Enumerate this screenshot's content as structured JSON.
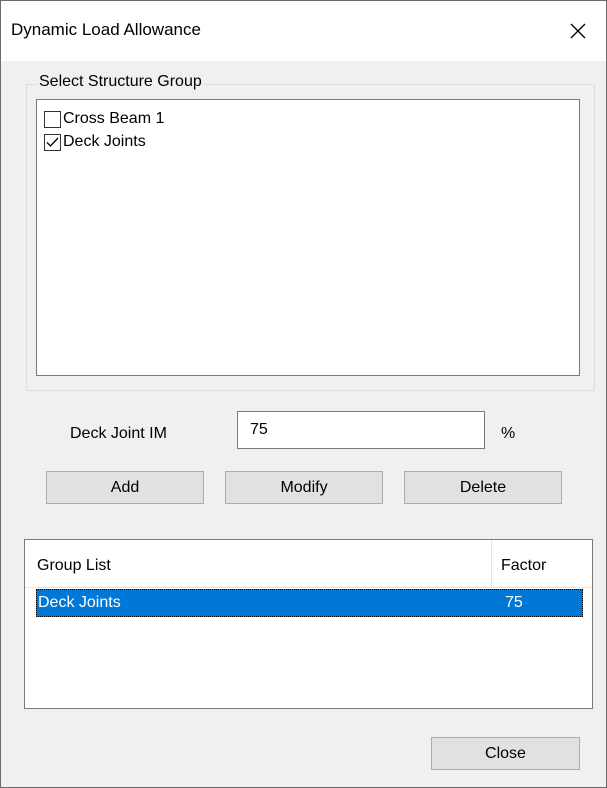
{
  "window": {
    "title": "Dynamic Load Allowance",
    "close_icon": "close-icon"
  },
  "structure_group": {
    "caption": "Select Structure Group",
    "items": [
      {
        "label": "Cross Beam 1",
        "checked": false
      },
      {
        "label": "Deck Joints",
        "checked": true
      }
    ]
  },
  "deck_joint_im": {
    "label": "Deck Joint IM",
    "value": "75",
    "unit": "%"
  },
  "buttons": {
    "add": "Add",
    "modify": "Modify",
    "delete": "Delete",
    "close": "Close"
  },
  "group_list": {
    "columns": [
      "Group List",
      "Factor"
    ],
    "rows": [
      {
        "group": "Deck Joints",
        "factor": "75",
        "selected": true
      }
    ]
  },
  "colors": {
    "selection": "#0078d7",
    "dialog_bg": "#f0f0f0",
    "button_bg": "#e1e1e1"
  }
}
